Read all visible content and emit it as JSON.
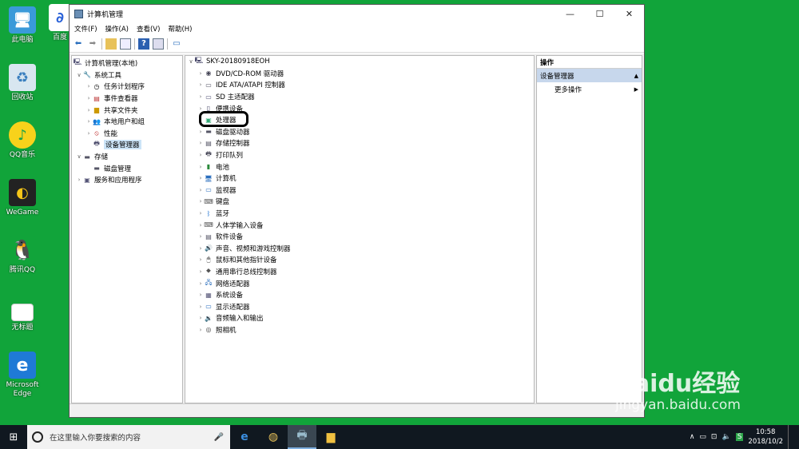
{
  "desktop": {
    "icons": [
      {
        "label": "此电脑",
        "icon": "computer-icon"
      },
      {
        "label": "回收站",
        "icon": "recycle-bin-icon"
      },
      {
        "label": "QQ音乐",
        "icon": "qq-music-icon"
      },
      {
        "label": "WeGame",
        "icon": "wegame-icon"
      },
      {
        "label": "腾讯QQ",
        "icon": "qq-icon"
      },
      {
        "label": "无标题",
        "icon": "untitled-icon"
      },
      {
        "label": "Microsoft Edge",
        "icon": "edge-icon"
      },
      {
        "label": "百度",
        "icon": "baidu-icon"
      }
    ]
  },
  "window": {
    "title": "计算机管理",
    "menu": [
      "文件(F)",
      "操作(A)",
      "查看(V)",
      "帮助(H)"
    ],
    "controls": {
      "minimize": "—",
      "maximize": "☐",
      "close": "✕"
    }
  },
  "left_tree": {
    "root": "计算机管理(本地)",
    "system_tools": "系统工具",
    "items": [
      "任务计划程序",
      "事件查看器",
      "共享文件夹",
      "本地用户和组",
      "性能",
      "设备管理器"
    ],
    "storage": "存储",
    "disk_mgmt": "磁盘管理",
    "services": "服务和应用程序"
  },
  "device_tree": {
    "root": "SKY-20180918EOH",
    "categories": [
      "DVD/CD-ROM 驱动器",
      "IDE ATA/ATAPI 控制器",
      "SD 主适配器",
      "便携设备",
      "处理器",
      "磁盘驱动器",
      "存储控制器",
      "打印队列",
      "电池",
      "计算机",
      "监视器",
      "键盘",
      "蓝牙",
      "人体学输入设备",
      "软件设备",
      "声音、视频和游戏控制器",
      "鼠标和其他指针设备",
      "通用串行总线控制器",
      "网络适配器",
      "系统设备",
      "显示适配器",
      "音频输入和输出",
      "照相机"
    ]
  },
  "actions": {
    "header": "操作",
    "section": "设备管理器",
    "more": "更多操作"
  },
  "taskbar": {
    "search_placeholder": "在这里输入你要搜索的内容",
    "time": "10:58",
    "date": "2018/10/2"
  },
  "watermark": {
    "main": "Baidu经验",
    "sub": "jingyan.baidu.com"
  }
}
